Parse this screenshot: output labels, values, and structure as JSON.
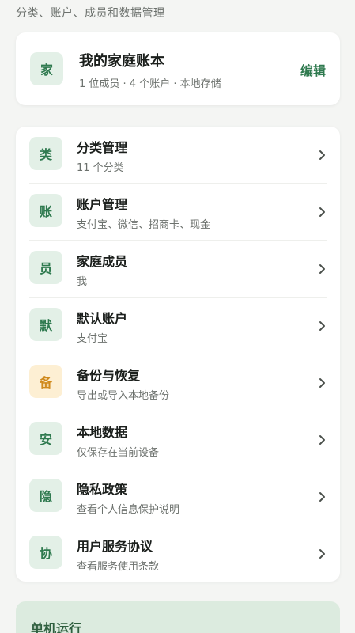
{
  "header": {
    "subtitle": "分类、账户、成员和数据管理"
  },
  "family": {
    "badge": "家",
    "title": "我的家庭账本",
    "meta": "1 位成员 · 4 个账户 · 本地存储",
    "edit_label": "编辑"
  },
  "menu": {
    "items": [
      {
        "badge": "类",
        "title": "分类管理",
        "subtitle": "11 个分类",
        "icon": "chevron-right-icon"
      },
      {
        "badge": "账",
        "title": "账户管理",
        "subtitle": "支付宝、微信、招商卡、现金",
        "icon": "chevron-right-icon"
      },
      {
        "badge": "员",
        "title": "家庭成员",
        "subtitle": "我",
        "icon": "chevron-right-icon"
      },
      {
        "badge": "默",
        "title": "默认账户",
        "subtitle": "支付宝",
        "icon": "chevron-right-icon"
      },
      {
        "badge": "备",
        "title": "备份与恢复",
        "subtitle": "导出或导入本地备份",
        "icon": "chevron-right-icon"
      },
      {
        "badge": "安",
        "title": "本地数据",
        "subtitle": "仅保存在当前设备",
        "icon": "chevron-right-icon"
      },
      {
        "badge": "隐",
        "title": "隐私政策",
        "subtitle": "查看个人信息保护说明",
        "icon": "chevron-right-icon"
      },
      {
        "badge": "协",
        "title": "用户服务协议",
        "subtitle": "查看服务使用条款",
        "icon": "chevron-right-icon"
      }
    ]
  },
  "offline": {
    "title": "单机运行"
  },
  "colors": {
    "accent": "#2f7a4f",
    "badge_bg": "#e3f0e7",
    "badge_warm_bg": "#fdefd3",
    "badge_warm_text": "#d08a1c",
    "page_bg": "#f4f5f3",
    "offline_bg": "#dcebdf"
  }
}
